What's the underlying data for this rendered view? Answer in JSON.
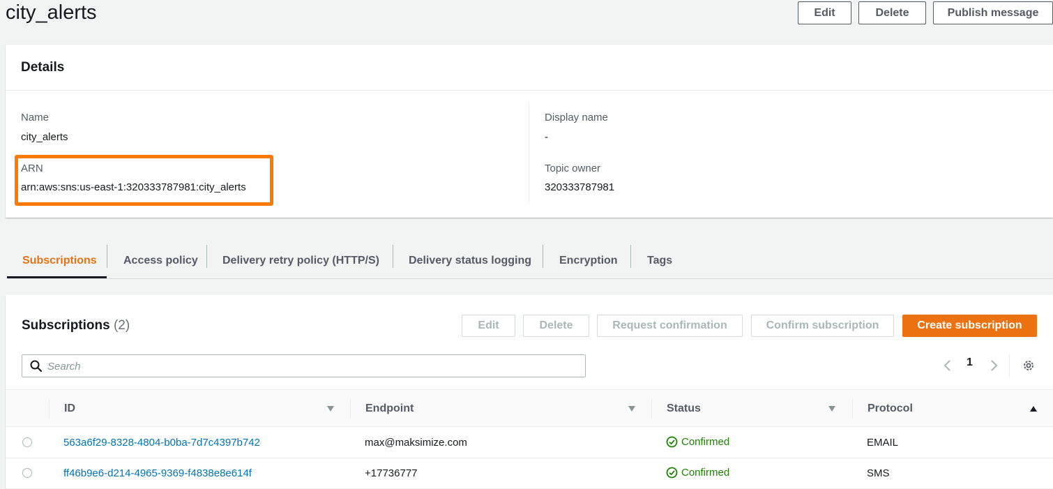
{
  "header": {
    "title": "city_alerts",
    "edit_label": "Edit",
    "delete_label": "Delete",
    "publish_label": "Publish message"
  },
  "details": {
    "heading": "Details",
    "name_label": "Name",
    "name_value": "city_alerts",
    "arn_label": "ARN",
    "arn_value": "arn:aws:sns:us-east-1:320333787981:city_alerts",
    "display_name_label": "Display name",
    "display_name_value": "-",
    "topic_owner_label": "Topic owner",
    "topic_owner_value": "320333787981",
    "highlight_color": "#ff7a00"
  },
  "tabs": [
    {
      "label": "Subscriptions",
      "active": true
    },
    {
      "label": "Access policy"
    },
    {
      "label": "Delivery retry policy (HTTP/S)"
    },
    {
      "label": "Delivery status logging"
    },
    {
      "label": "Encryption"
    },
    {
      "label": "Tags"
    }
  ],
  "subscriptions": {
    "title": "Subscriptions",
    "count": "(2)",
    "edit_label": "Edit",
    "delete_label": "Delete",
    "request_confirmation_label": "Request confirmation",
    "confirm_subscription_label": "Confirm subscription",
    "create_label": "Create subscription",
    "search_placeholder": "Search",
    "page": "1",
    "columns": {
      "id": "ID",
      "endpoint": "Endpoint",
      "status": "Status",
      "protocol": "Protocol"
    },
    "rows": [
      {
        "id": "563a6f29-8328-4804-b0ba-7d7c4397b742",
        "endpoint": "max@maksimize.com",
        "status": "Confirmed",
        "protocol": "EMAIL"
      },
      {
        "id": "ff46b9e6-d214-4965-9369-f4838e8e614f",
        "endpoint": "+17736777",
        "status": "Confirmed",
        "protocol": "SMS"
      }
    ]
  },
  "colors": {
    "accent": "#ec7211",
    "link": "#0073bb",
    "success": "#1d8102"
  }
}
